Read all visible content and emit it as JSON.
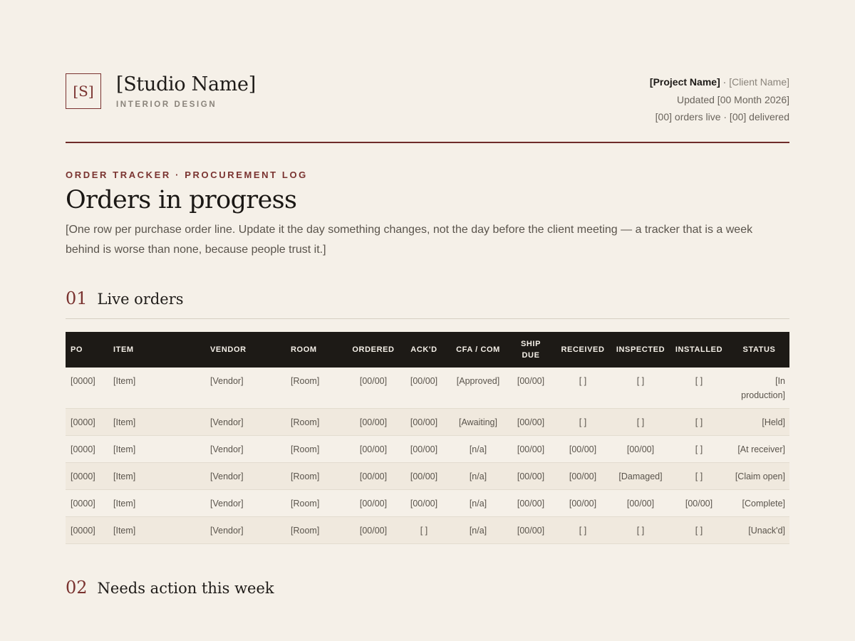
{
  "header": {
    "monogram": "[S]",
    "studio_name": "[Studio Name]",
    "studio_sub": "INTERIOR DESIGN",
    "project_name": "[Project Name]",
    "separator": " · ",
    "client_name": "[Client Name]",
    "updated": "Updated [00 Month 2026]",
    "counts": "[00] orders live · [00] delivered"
  },
  "intro": {
    "eyebrow": "ORDER TRACKER · PROCUREMENT LOG",
    "title": "Orders in progress",
    "lede": "[One row per purchase order line. Update it the day something changes, not the day before the client meeting — a tracker that is a week behind is worse than none, because people trust it.]"
  },
  "sections": [
    {
      "num": "01",
      "title": "Live orders"
    },
    {
      "num": "02",
      "title": "Needs action this week"
    }
  ],
  "table": {
    "columns": [
      "PO",
      "ITEM",
      "VENDOR",
      "ROOM",
      "ORDERED",
      "ACK'D",
      "CFA / COM",
      "SHIP DUE",
      "RECEIVED",
      "INSPECTED",
      "INSTALLED",
      "STATUS"
    ],
    "rows": [
      [
        "[0000]",
        "[Item]",
        "[Vendor]",
        "[Room]",
        "[00/00]",
        "[00/00]",
        "[Approved]",
        "[00/00]",
        "[ ]",
        "[ ]",
        "[ ]",
        "[In production]"
      ],
      [
        "[0000]",
        "[Item]",
        "[Vendor]",
        "[Room]",
        "[00/00]",
        "[00/00]",
        "[Awaiting]",
        "[00/00]",
        "[ ]",
        "[ ]",
        "[ ]",
        "[Held]"
      ],
      [
        "[0000]",
        "[Item]",
        "[Vendor]",
        "[Room]",
        "[00/00]",
        "[00/00]",
        "[n/a]",
        "[00/00]",
        "[00/00]",
        "[00/00]",
        "[ ]",
        "[At receiver]"
      ],
      [
        "[0000]",
        "[Item]",
        "[Vendor]",
        "[Room]",
        "[00/00]",
        "[00/00]",
        "[n/a]",
        "[00/00]",
        "[00/00]",
        "[Damaged]",
        "[ ]",
        "[Claim open]"
      ],
      [
        "[0000]",
        "[Item]",
        "[Vendor]",
        "[Room]",
        "[00/00]",
        "[00/00]",
        "[n/a]",
        "[00/00]",
        "[00/00]",
        "[00/00]",
        "[00/00]",
        "[Complete]"
      ],
      [
        "[0000]",
        "[Item]",
        "[Vendor]",
        "[Room]",
        "[00/00]",
        "[ ]",
        "[n/a]",
        "[00/00]",
        "[ ]",
        "[ ]",
        "[ ]",
        "[Unack'd]"
      ]
    ]
  },
  "colors": {
    "accent": "#7a3330",
    "background": "#f5f0e8",
    "table_header": "#1d1a16"
  }
}
